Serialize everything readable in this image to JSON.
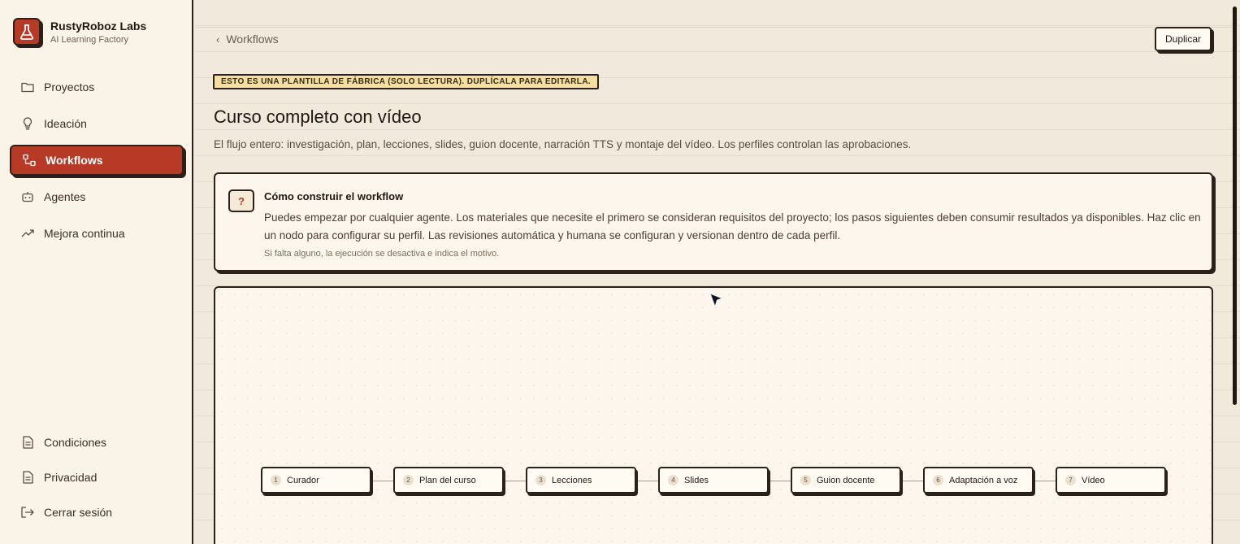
{
  "brand": {
    "name": "RustyRoboz Labs",
    "subtitle": "AI Learning Factory"
  },
  "sidebar": {
    "items": [
      {
        "label": "Proyectos",
        "icon": "folder-icon"
      },
      {
        "label": "Ideación",
        "icon": "lightbulb-icon"
      },
      {
        "label": "Workflows",
        "icon": "workflow-icon",
        "active": true
      },
      {
        "label": "Agentes",
        "icon": "robot-icon"
      },
      {
        "label": "Mejora continua",
        "icon": "trending-up-icon"
      }
    ],
    "bottom_items": [
      {
        "label": "Condiciones",
        "icon": "document-icon"
      },
      {
        "label": "Privacidad",
        "icon": "document-icon"
      },
      {
        "label": "Cerrar sesión",
        "icon": "logout-icon"
      }
    ]
  },
  "header": {
    "back_label": "Workflows",
    "duplicate_label": "Duplicar"
  },
  "banner": "ESTO ES UNA PLANTILLA DE FÁBRICA (SOLO LECTURA). DUPLÍCALA PARA EDITARLA.",
  "page": {
    "title": "Curso completo con vídeo",
    "subtitle": "El flujo entero: investigación, plan, lecciones, slides, guion docente, narración TTS y montaje del vídeo. Los perfiles controlan las aprobaciones."
  },
  "help": {
    "icon_text": "?",
    "title": "Cómo construir el workflow",
    "body": "Puedes empezar por cualquier agente. Los materiales que necesite el primero se consideran requisitos del proyecto; los pasos siguientes deben consumir resultados ya disponibles. Haz clic en un nodo para configurar su perfil. Las revisiones automática y humana se configuran y versionan dentro de cada perfil.",
    "note": "Si falta alguno, la ejecución se desactiva e indica el motivo."
  },
  "workflow": {
    "nodes": [
      {
        "num": "1",
        "label": "Curador"
      },
      {
        "num": "2",
        "label": "Plan del curso"
      },
      {
        "num": "3",
        "label": "Lecciones"
      },
      {
        "num": "4",
        "label": "Slides"
      },
      {
        "num": "5",
        "label": "Guion docente"
      },
      {
        "num": "6",
        "label": "Adaptación a voz"
      },
      {
        "num": "7",
        "label": "Vídeo"
      }
    ]
  },
  "colors": {
    "accent": "#b73a26",
    "ink": "#2b211a",
    "paper": "#fcf6ec",
    "banner": "#f4dfa0"
  }
}
